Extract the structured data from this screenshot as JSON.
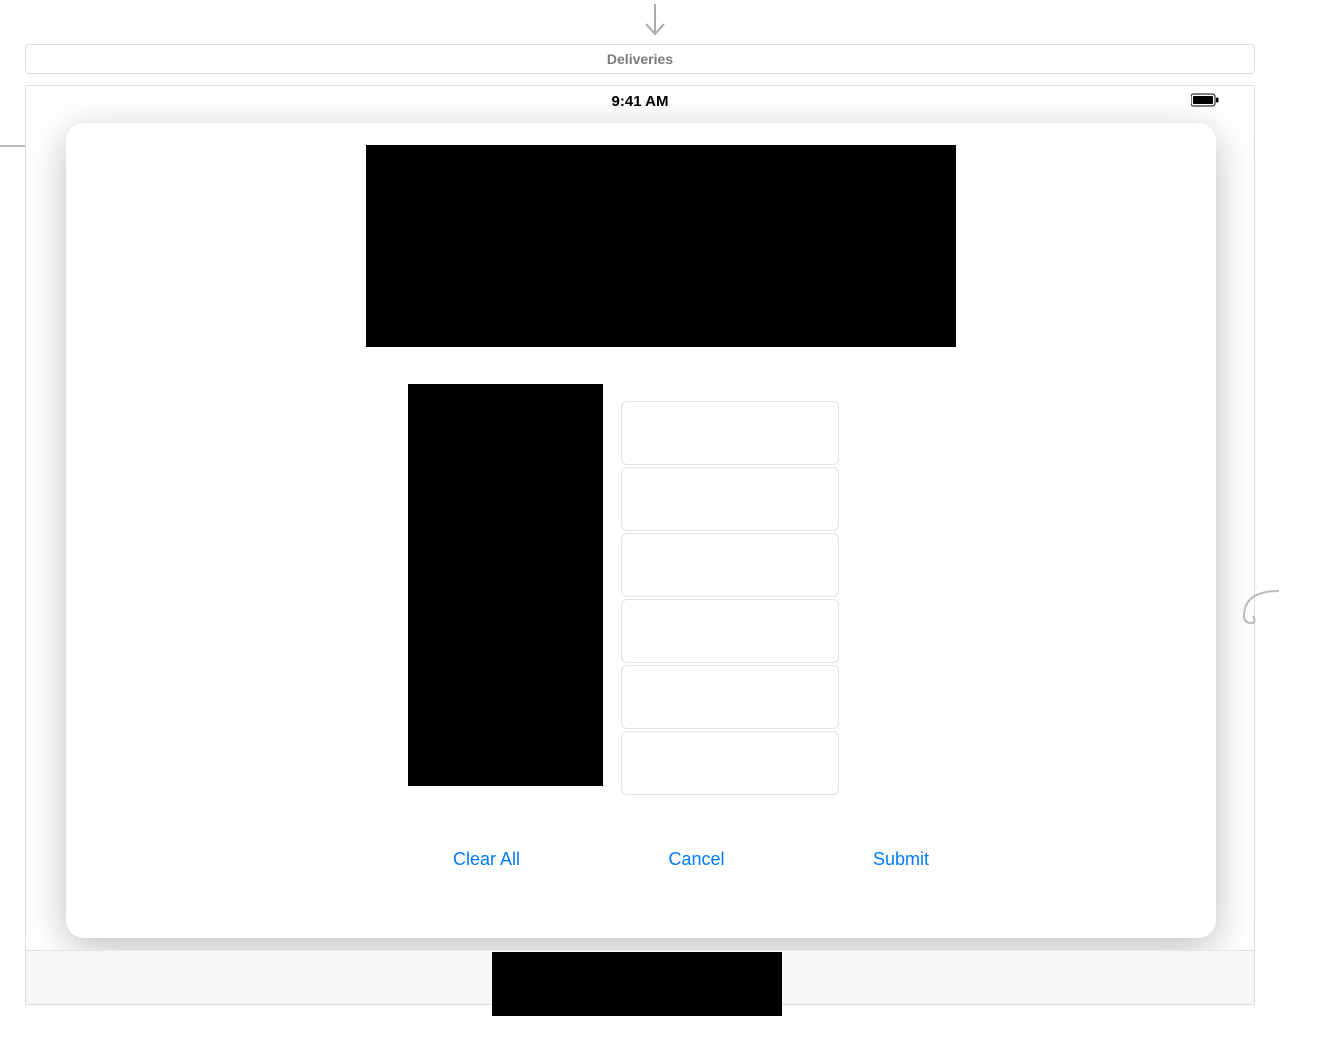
{
  "header": {
    "title": "Deliveries"
  },
  "status_bar": {
    "time": "9:41 AM"
  },
  "modal": {
    "fields": [
      {
        "value": ""
      },
      {
        "value": ""
      },
      {
        "value": ""
      },
      {
        "value": ""
      },
      {
        "value": ""
      },
      {
        "value": ""
      }
    ],
    "buttons": {
      "clear_all_label": "Clear All",
      "cancel_label": "Cancel",
      "submit_label": "Submit"
    }
  }
}
